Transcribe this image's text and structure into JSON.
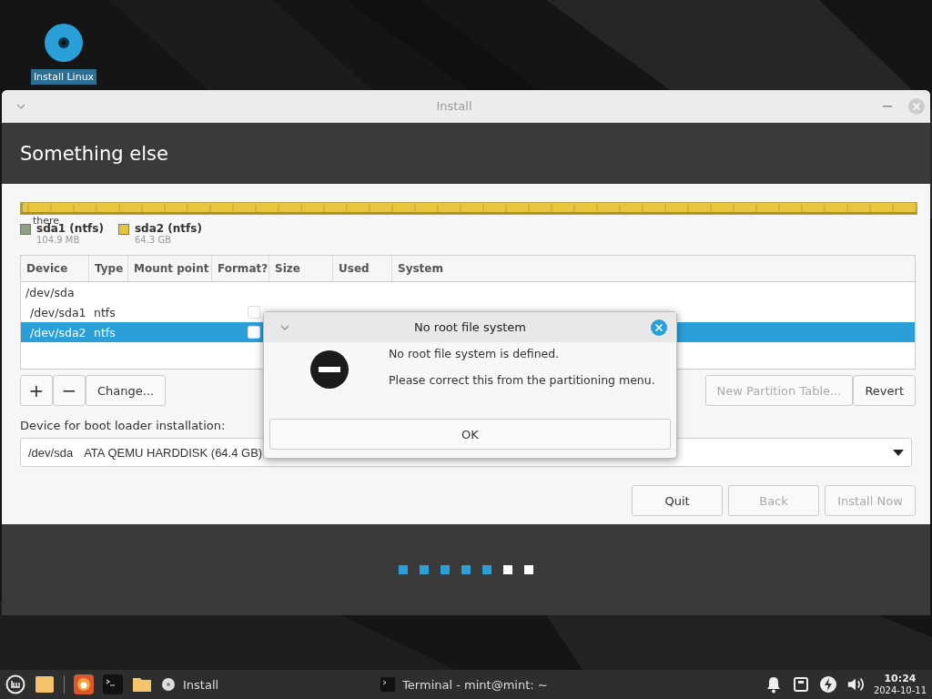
{
  "desktop_icon": {
    "label": "Install Linux"
  },
  "window": {
    "title": "Install"
  },
  "header": {
    "title": "Something else"
  },
  "partition_bar": {
    "marker": "there",
    "legend": [
      {
        "name": "sda1 (ntfs)",
        "size": "104.9 MB",
        "color": "#8aa080"
      },
      {
        "name": "sda2 (ntfs)",
        "size": "64.3 GB",
        "color": "#e8c53e"
      }
    ]
  },
  "table": {
    "columns": [
      "Device",
      "Type",
      "Mount point",
      "Format?",
      "Size",
      "Used",
      "System"
    ],
    "rows": [
      {
        "device": "/dev/sda",
        "selected": false,
        "children": [
          {
            "device": "/dev/sda1",
            "type": "ntfs",
            "format": false,
            "selected": false
          },
          {
            "device": "/dev/sda2",
            "type": "ntfs",
            "format": false,
            "selected": true
          }
        ]
      }
    ]
  },
  "table_buttons": [
    {
      "kind": "add",
      "label": "+",
      "disabled": false
    },
    {
      "kind": "remove",
      "label": "−",
      "disabled": false
    },
    {
      "kind": "text",
      "label": "Change...",
      "disabled": false
    }
  ],
  "table_buttons_right": [
    {
      "label": "New Partition Table...",
      "disabled": true
    },
    {
      "label": "Revert",
      "disabled": false
    }
  ],
  "boot_loader": {
    "label": "Device for boot loader installation:",
    "device": "/dev/sda",
    "description": "ATA QEMU HARDDISK (64.4 GB)"
  },
  "nav_buttons": [
    {
      "label": "Quit",
      "disabled": false
    },
    {
      "label": "Back",
      "disabled": true
    },
    {
      "label": "Install Now",
      "disabled": true
    }
  ],
  "progress_steps": [
    {
      "completed": true
    },
    {
      "completed": true
    },
    {
      "completed": true
    },
    {
      "completed": true
    },
    {
      "completed": true
    },
    {
      "completed": false
    },
    {
      "completed": false
    }
  ],
  "dialog": {
    "title": "No root file system",
    "message": "No root file system is defined.",
    "detail": "Please correct this from the partitioning menu.",
    "button": "OK"
  },
  "taskbar": {
    "tasks": [
      {
        "kind": "installer",
        "label": "Install"
      },
      {
        "kind": "terminal",
        "label": "Terminal - mint@mint: ~"
      }
    ],
    "time": "10:24",
    "date": "2024-10-11"
  }
}
